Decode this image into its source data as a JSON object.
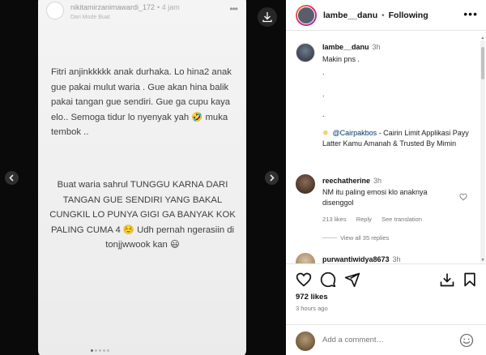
{
  "story": {
    "username": "nikitamirzanimawardi_172",
    "time": "• 4 jam",
    "subtitle": "Dari Mode Buat",
    "more_icon": "•••",
    "paragraph1": "Fitri anjinkkkkk anak durhaka. Lo hina2 anak gue pakai mulut waria . Gue akan hina balik pakai tangan gue sendiri. Gue ga cupu kaya elo.. Semoga tidur lo nyenyak yah 🤣 muka tembok ..",
    "paragraph2": "Buat waria sahrul TUNGGU KARNA DARI TANGAN GUE SENDIRI YANG BAKAL CUNGKIL LO PUNYA GIGI GA BANYAK KOK PALING CUMA 4 ☺️ Udh pernah ngerasiin di tonjjwwook kan 😃"
  },
  "header": {
    "username": "lambe__danu",
    "separator": "•",
    "follow_label": "Following",
    "more_icon": "•••"
  },
  "caption": {
    "username": "lambe__danu",
    "time": "3h",
    "line1": "Makin pns .",
    "dot1": ".",
    "dot2": ".",
    "dot3": ".",
    "sparkle": "✵",
    "mention": "@Cairpakbos",
    "promo": " - Cairin Limit Applikasi Payy Latter Kamu Amanah & Trusted By Mimin"
  },
  "comment1": {
    "username": "reechatherine",
    "time": "3h",
    "text": "NM itu paling emosi klo anaknya disenggol",
    "likes": "213 likes",
    "reply": "Reply",
    "translation": "See translation"
  },
  "view_all": "View all 35 replies",
  "comment2": {
    "username": "purwantiwidya8673",
    "time": "3h"
  },
  "likes_count": "972 likes",
  "posted_ago": "3 hours ago",
  "add_comment": {
    "placeholder": "Add a comment…"
  },
  "colors": {
    "accent_link": "#00376b",
    "story_ring_start": "#f58529",
    "story_ring_end": "#8134af"
  }
}
